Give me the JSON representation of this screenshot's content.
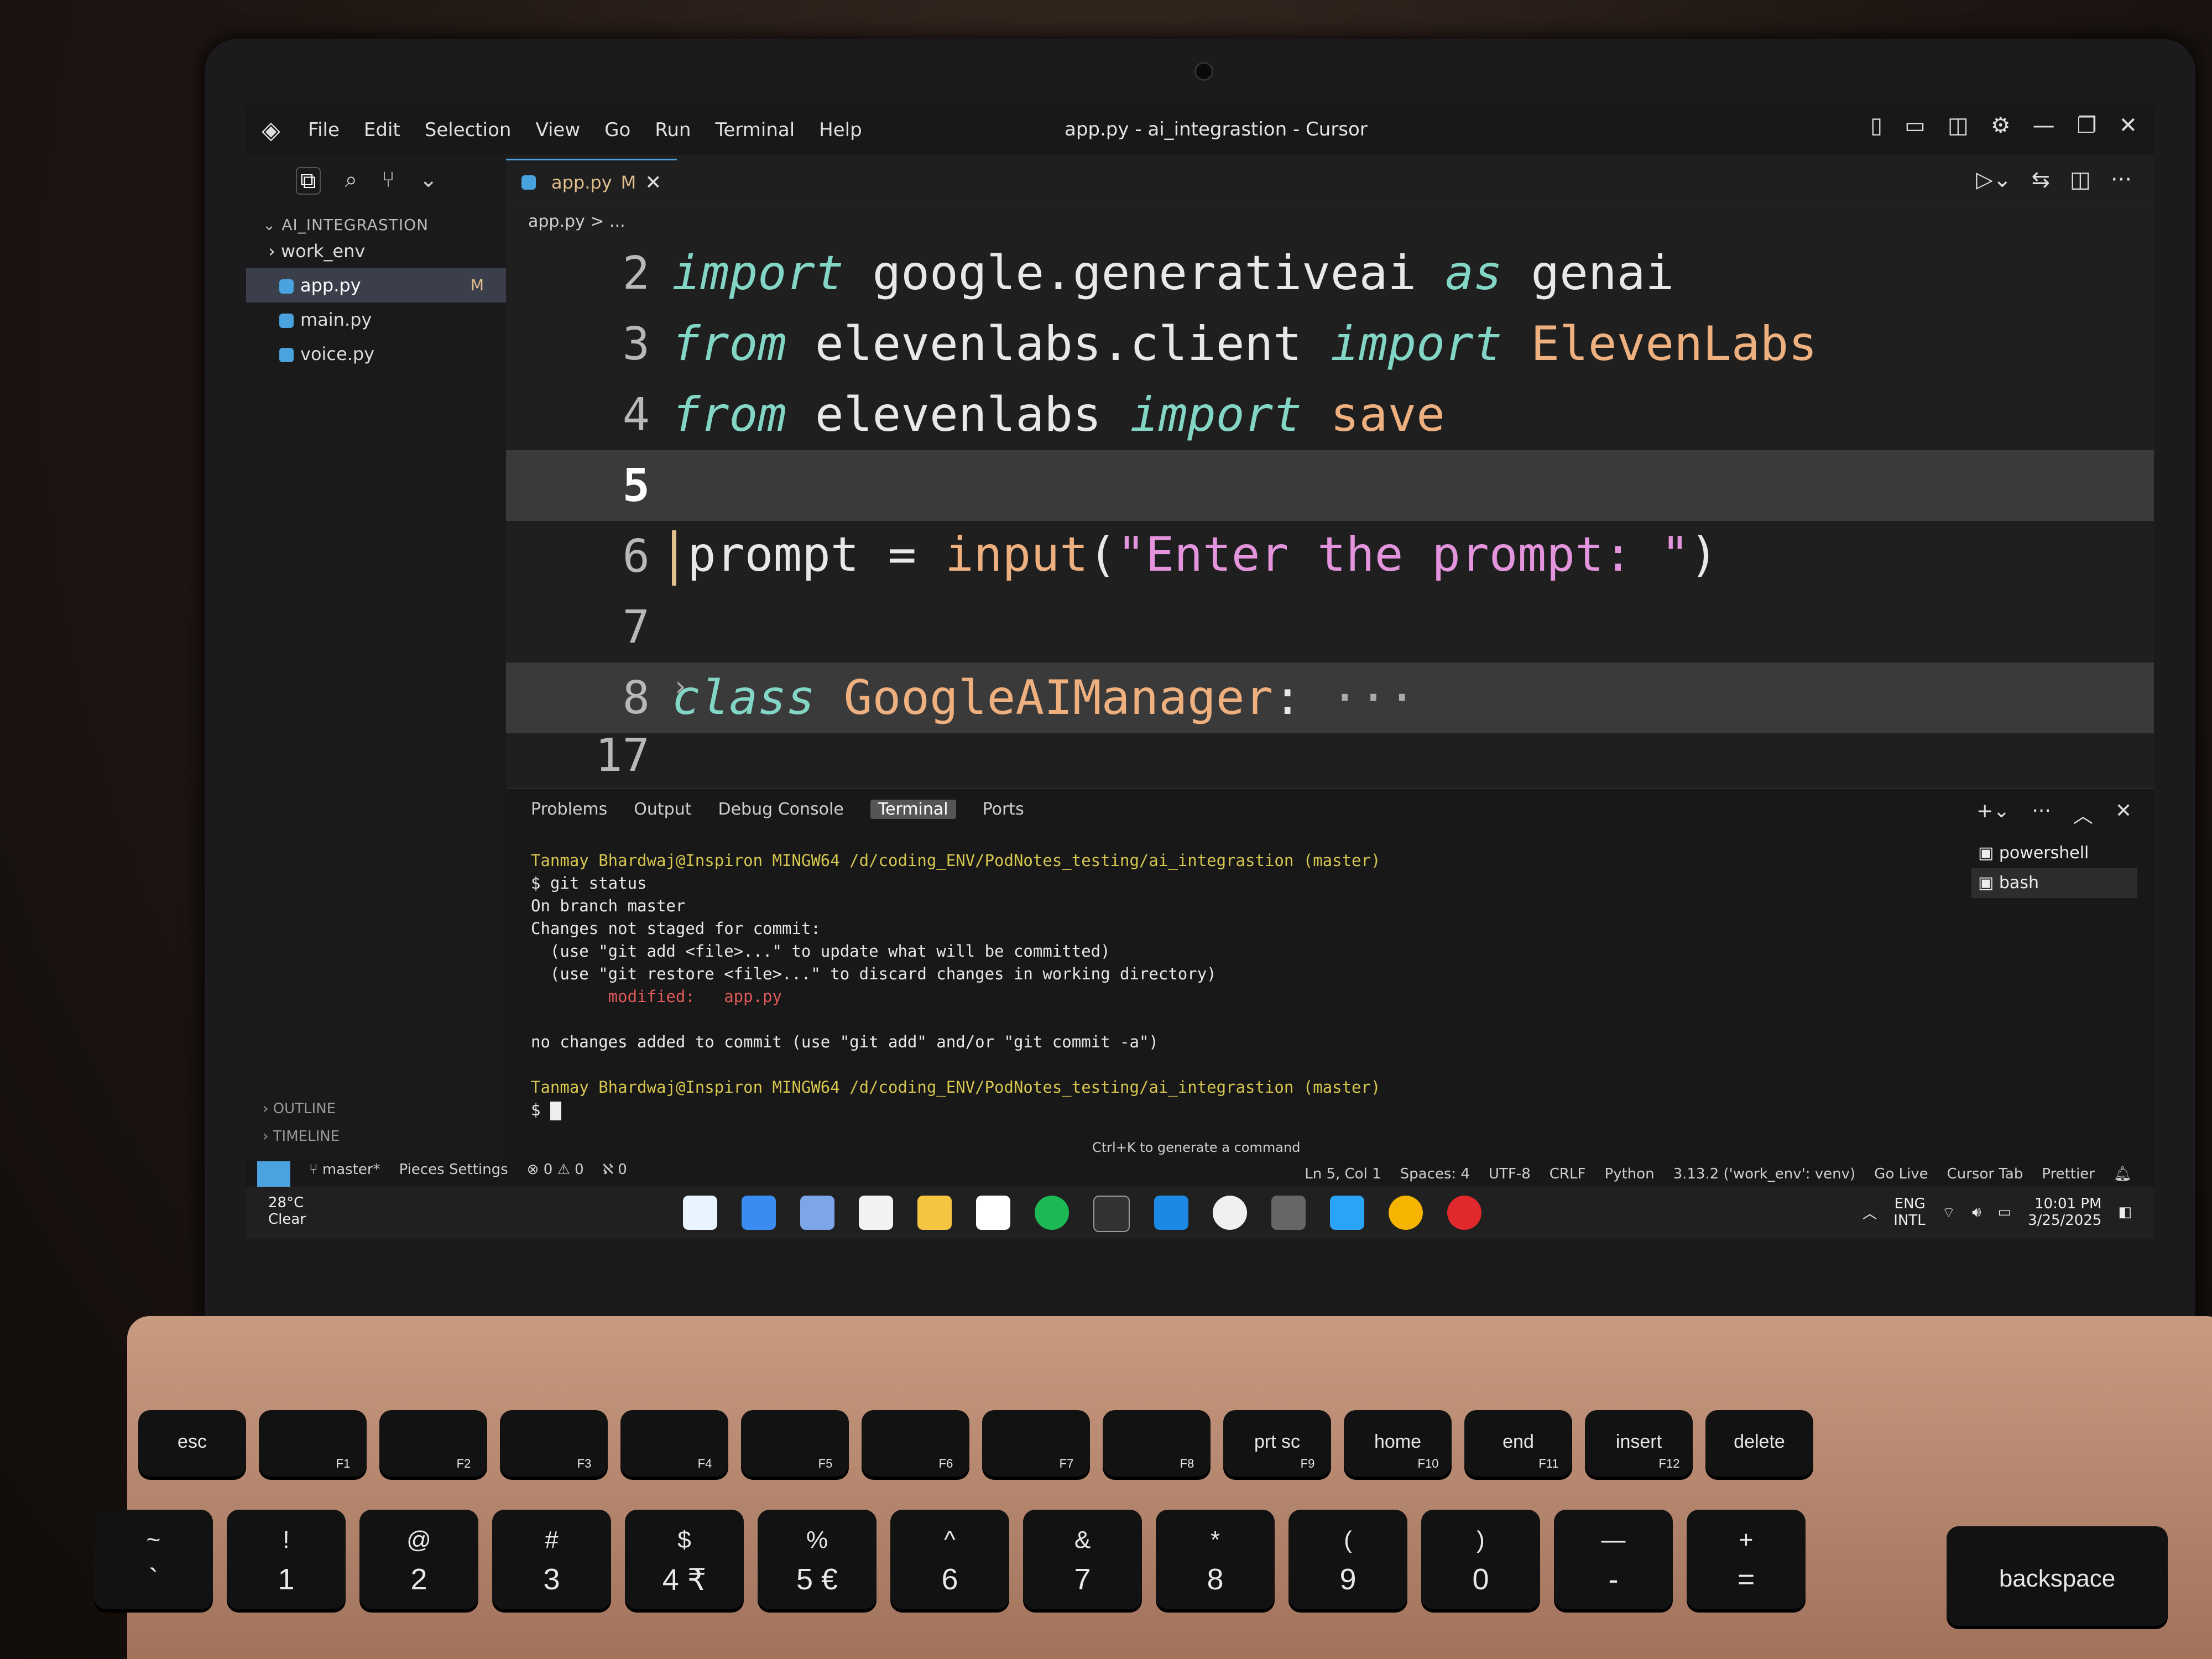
{
  "window": {
    "title": "app.py - ai_integrastion - Cursor"
  },
  "menu": [
    "File",
    "Edit",
    "Selection",
    "View",
    "Go",
    "Run",
    "Terminal",
    "Help"
  ],
  "sidebar": {
    "section": "AI_INTEGRASTION",
    "items": [
      {
        "label": "work_env",
        "type": "folder"
      },
      {
        "label": "app.py",
        "badge": "M",
        "selected": true
      },
      {
        "label": "main.py"
      },
      {
        "label": "voice.py"
      }
    ],
    "outline": "OUTLINE",
    "timeline": "TIMELINE"
  },
  "editor": {
    "tab": {
      "label": "app.py",
      "badge": "M"
    },
    "breadcrumb": "app.py > ...",
    "lines": [
      {
        "num": "2"
      },
      {
        "num": "3"
      },
      {
        "num": "4"
      },
      {
        "num": "5"
      },
      {
        "num": "6"
      },
      {
        "num": "7"
      },
      {
        "num": "8"
      },
      {
        "num": "17"
      }
    ],
    "code": {
      "l2a": "import",
      "l2b": " google.generativeai ",
      "l2c": "as",
      "l2d": " genai",
      "l3a": "from",
      "l3b": " elevenlabs.client ",
      "l3c": "import",
      "l3d": " ElevenLabs",
      "l4a": "from",
      "l4b": " elevenlabs ",
      "l4c": "import",
      "l4d": " save",
      "l6a": "prompt = ",
      "l6b": "input",
      "l6c": "(",
      "l6d": "\"Enter the prompt: \"",
      "l6e": ")",
      "l8a": "class",
      "l8b": " GoogleAIManager",
      "l8c": ":",
      "l8d": " ···"
    }
  },
  "panel": {
    "tabs": [
      "Problems",
      "Output",
      "Debug Console",
      "Terminal",
      "Ports"
    ],
    "active_tab": "Terminal",
    "terminals": [
      "powershell",
      "bash"
    ],
    "hint": "Ctrl+K to generate a command",
    "terminal_lines": {
      "p1_user": "Tanmay Bhardwaj@Inspiron",
      "p1_path": " MINGW64 /d/coding_ENV/PodNotes_testing/ai_integrastion (master)",
      "cmd": "$ git status",
      "o1": "On branch master",
      "o2": "Changes not staged for commit:",
      "o3": "  (use \"git add <file>...\" to update what will be committed)",
      "o4": "  (use \"git restore <file>...\" to discard changes in working directory)",
      "o5": "        modified:   app.py",
      "o6": "no changes added to commit (use \"git add\" and/or \"git commit -a\")",
      "p2_user": "Tanmay Bhardwaj@Inspiron",
      "p2_path": " MINGW64 /d/coding_ENV/PodNotes_testing/ai_integrastion (master)",
      "p2": "$"
    }
  },
  "status": {
    "branch": "master*",
    "pieces": "Pieces Settings",
    "problems": "⊗ 0 ⚠ 0",
    "ports": "ℵ 0",
    "ln_col": "Ln 5, Col 1",
    "spaces": "Spaces: 4",
    "encoding": "UTF-8",
    "eol": "CRLF",
    "language": "Python",
    "interpreter": "3.13.2 ('work_env': venv)",
    "go_live": "Go Live",
    "cursor_tab": "Cursor Tab",
    "prettier": "Prettier"
  },
  "taskbar": {
    "temp": "28°C",
    "weather": "Clear",
    "lang1": "ENG",
    "lang2": "INTL",
    "time": "10:01 PM",
    "date": "3/25/2025"
  },
  "keyboard": {
    "fn_row": [
      "esc",
      "",
      "",
      "",
      "",
      "",
      "",
      "",
      "",
      "prt sc",
      "home",
      "end",
      "insert",
      "delete"
    ],
    "fn_sub": [
      "",
      "F1",
      "F2",
      "F3",
      "F4",
      "F5",
      "F6",
      "F7",
      "F8",
      "F9",
      "F10",
      "F11",
      "F12",
      ""
    ],
    "num_top": [
      "~",
      "!",
      "@",
      "#",
      "$",
      "%",
      "^",
      "&",
      "*",
      "(",
      ")",
      "—",
      "+"
    ],
    "num_bot": [
      "`",
      "1",
      "2",
      "3",
      "4 ₹",
      "5 €",
      "6",
      "7",
      "8",
      "9",
      "0",
      "-",
      "="
    ],
    "backspace": "backspace"
  }
}
